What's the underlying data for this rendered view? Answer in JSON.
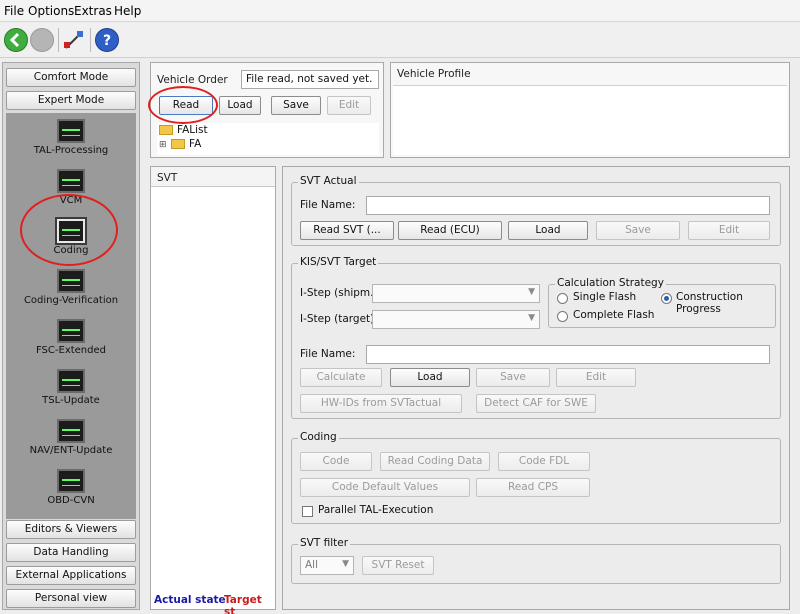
{
  "menu": [
    "File",
    "Options",
    "Extras",
    "Help"
  ],
  "toolbar": {
    "icons": [
      "back-arrow-icon",
      "stop-icon",
      "connection-icon",
      "help-icon"
    ]
  },
  "sidebar": {
    "top_tabs": [
      "Comfort Mode",
      "Expert Mode"
    ],
    "tools": [
      "TAL-Processing",
      "VCM",
      "Coding",
      "Coding-Verification",
      "FSC-Extended",
      "TSL-Update",
      "NAV/ENT-Update",
      "OBD-CVN"
    ],
    "selected_tool": "Coding",
    "bottom_tabs": [
      "Editors & Viewers",
      "Data Handling",
      "External Applications",
      "Personal view"
    ]
  },
  "vehicle_order": {
    "title": "Vehicle Order",
    "status": "File read, not saved yet.",
    "buttons": [
      "Read",
      "Load",
      "Save",
      "Edit"
    ],
    "tree": [
      "FAList",
      "FA"
    ]
  },
  "vehicle_profile": {
    "title": "Vehicle Profile"
  },
  "svt_list": {
    "title": "SVT",
    "actual_state": "Actual state",
    "target_state": "Target st"
  },
  "svt_actual": {
    "legend": "SVT Actual",
    "file_name_label": "File Name:",
    "file_name_value": "",
    "buttons": [
      "Read SVT (...",
      "Read (ECU)",
      "Load",
      "Save",
      "Edit"
    ]
  },
  "kis_target": {
    "legend": "KIS/SVT Target",
    "istep_shipm_label": "I-Step (shipm.):",
    "istep_target_label": "I-Step (target):",
    "calc_legend": "Calculation Strategy",
    "radio_single": "Single Flash",
    "radio_construction": "Construction Progress",
    "radio_complete": "Complete Flash",
    "selected_strategy": "Construction Progress",
    "file_name_label": "File Name:",
    "file_name_value": "",
    "buttons": [
      "Calculate",
      "Load",
      "Save",
      "Edit"
    ],
    "buttons2": [
      "HW-IDs from SVTactual",
      "Detect CAF for SWE"
    ]
  },
  "coding": {
    "legend": "Coding",
    "buttons": [
      "Code",
      "Read Coding Data",
      "Code FDL"
    ],
    "buttons2": [
      "Code Default Values",
      "Read CPS"
    ],
    "parallel_label": "Parallel TAL-Execution"
  },
  "svt_filter": {
    "legend": "SVT filter",
    "filter_value": "All",
    "reset_label": "SVT Reset"
  },
  "colors": {
    "actual_state": "#1a1aa8",
    "target_state": "#c81a1a",
    "annotation": "#e02020"
  }
}
